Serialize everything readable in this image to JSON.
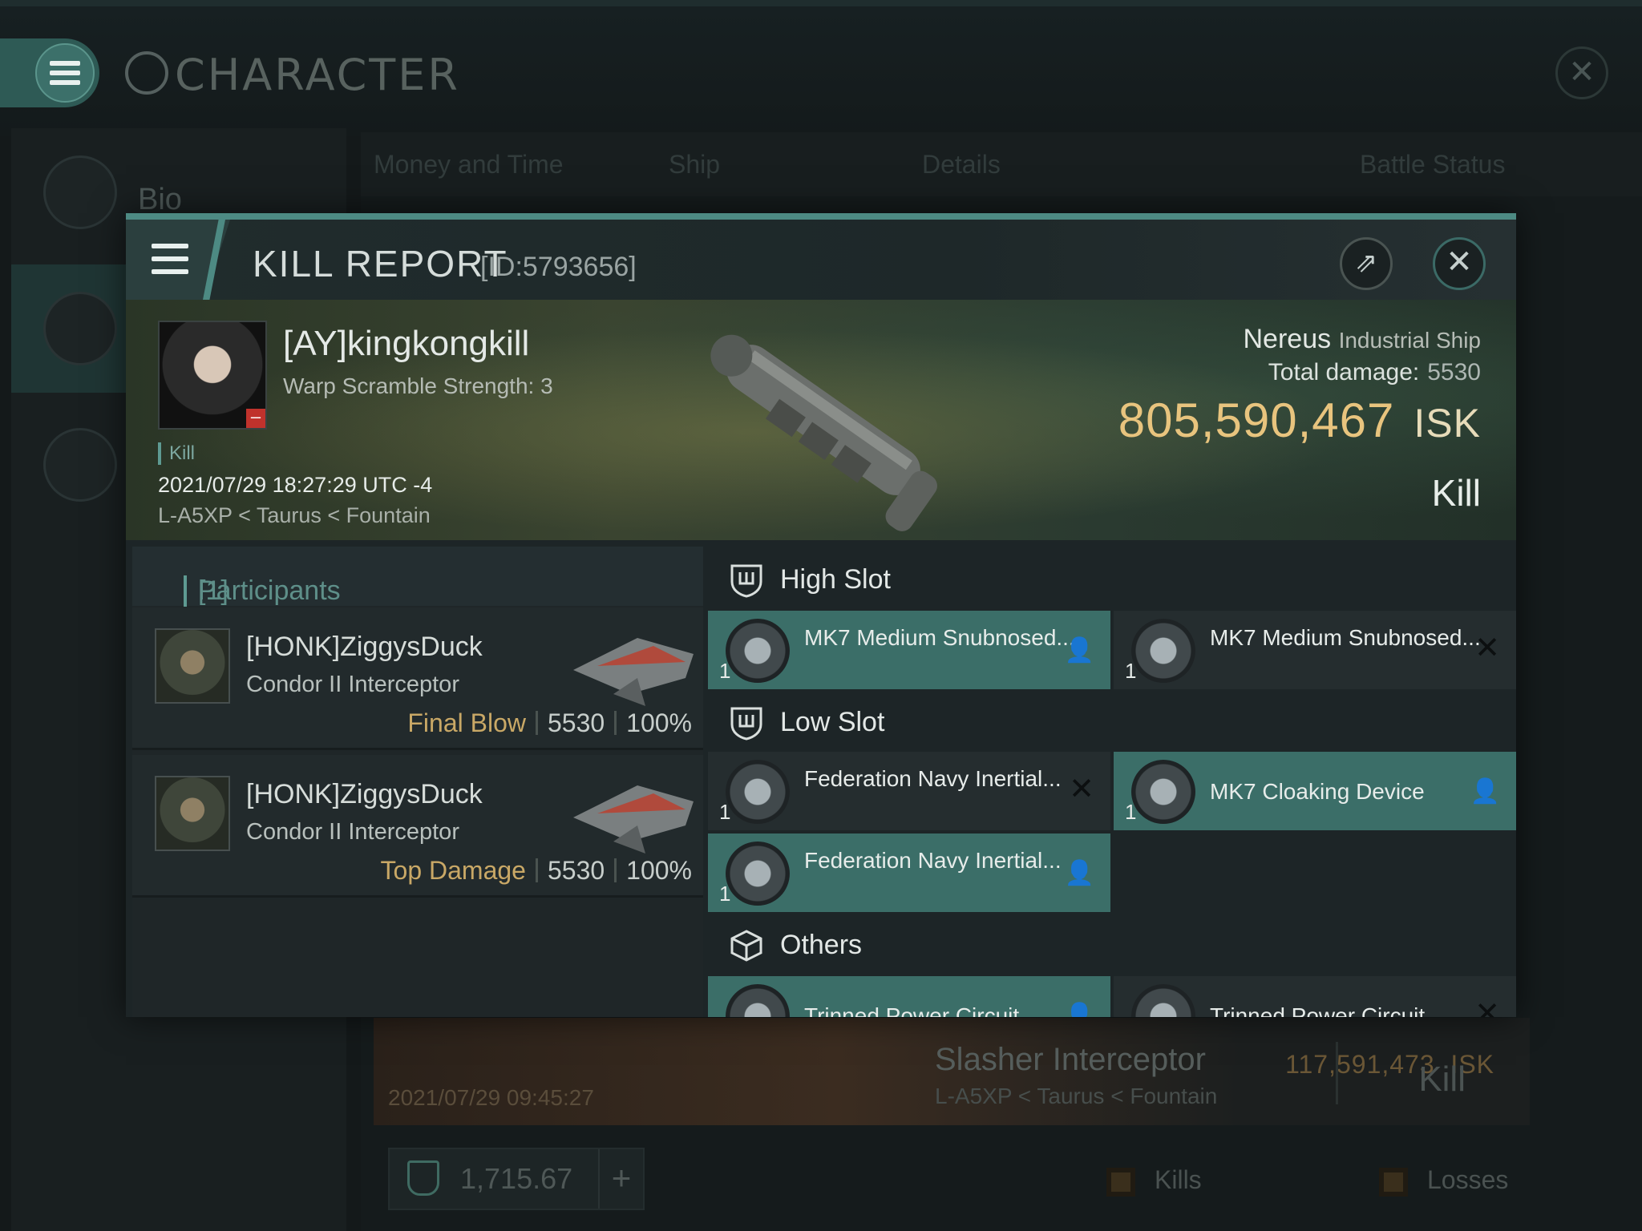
{
  "window": {
    "title": "CHARACTER",
    "sidebar": [
      {
        "label": "Bio"
      },
      {
        "label": ""
      },
      {
        "label": ""
      }
    ],
    "tabs": [
      "Money and Time",
      "Ship",
      "Details",
      "Battle Status"
    ],
    "background_row": {
      "isk": "117,591,473",
      "isk_unit": "ISK",
      "date": "2021/07/29 09:45:27",
      "ship": "Slasher Interceptor",
      "location": "L-A5XP < Taurus < Fountain",
      "result": "Kill"
    },
    "footer": {
      "plex_value": "1,715.67",
      "kills_label": "Kills",
      "losses_label": "Losses"
    }
  },
  "kill_report": {
    "title": "KILL REPORT",
    "id": "[ID:5793656]",
    "pilot": {
      "name": "[AY]kingkongkill",
      "subtitle": "Warp Scramble Strength: 3",
      "tag": "Kill",
      "time": "2021/07/29 18:27:29 UTC -4",
      "location": "L-A5XP < Taurus < Fountain"
    },
    "victim": {
      "ship": "Nereus",
      "ship_class": "Industrial Ship",
      "damage_label": "Total damage:",
      "damage_value": "5530",
      "isk_value": "805,590,467",
      "isk_unit": "ISK",
      "result": "Kill"
    },
    "participants": {
      "label": "Participants",
      "count": "[1]",
      "rows": [
        {
          "name": "[HONK]ZiggysDuck",
          "ship": "Condor II Interceptor",
          "role": "Final Blow",
          "damage": "5530",
          "percent": "100%"
        },
        {
          "name": "[HONK]ZiggysDuck",
          "ship": "Condor II Interceptor",
          "role": "Top Damage",
          "damage": "5530",
          "percent": "100%"
        }
      ]
    },
    "slots": {
      "high": {
        "label": "High Slot",
        "modules": [
          {
            "name": "MK7 Medium Snubnosed...",
            "qty": "1",
            "status": "fitted"
          },
          {
            "name": "MK7 Medium Snubnosed...",
            "qty": "1",
            "status": "destroyed"
          }
        ]
      },
      "low": {
        "label": "Low Slot",
        "modules": [
          {
            "name": "Federation Navy Inertial...",
            "qty": "1",
            "status": "destroyed"
          },
          {
            "name": "MK7 Cloaking Device",
            "qty": "1",
            "status": "fitted"
          },
          {
            "name": "Federation Navy Inertial...",
            "qty": "1",
            "status": "fitted"
          }
        ]
      },
      "others": {
        "label": "Others",
        "modules": [
          {
            "name": "Trinned Power Circuit",
            "qty": "",
            "status": "fitted"
          },
          {
            "name": "Trinned Power Circuit",
            "qty": "",
            "status": "destroyed"
          }
        ]
      }
    }
  }
}
